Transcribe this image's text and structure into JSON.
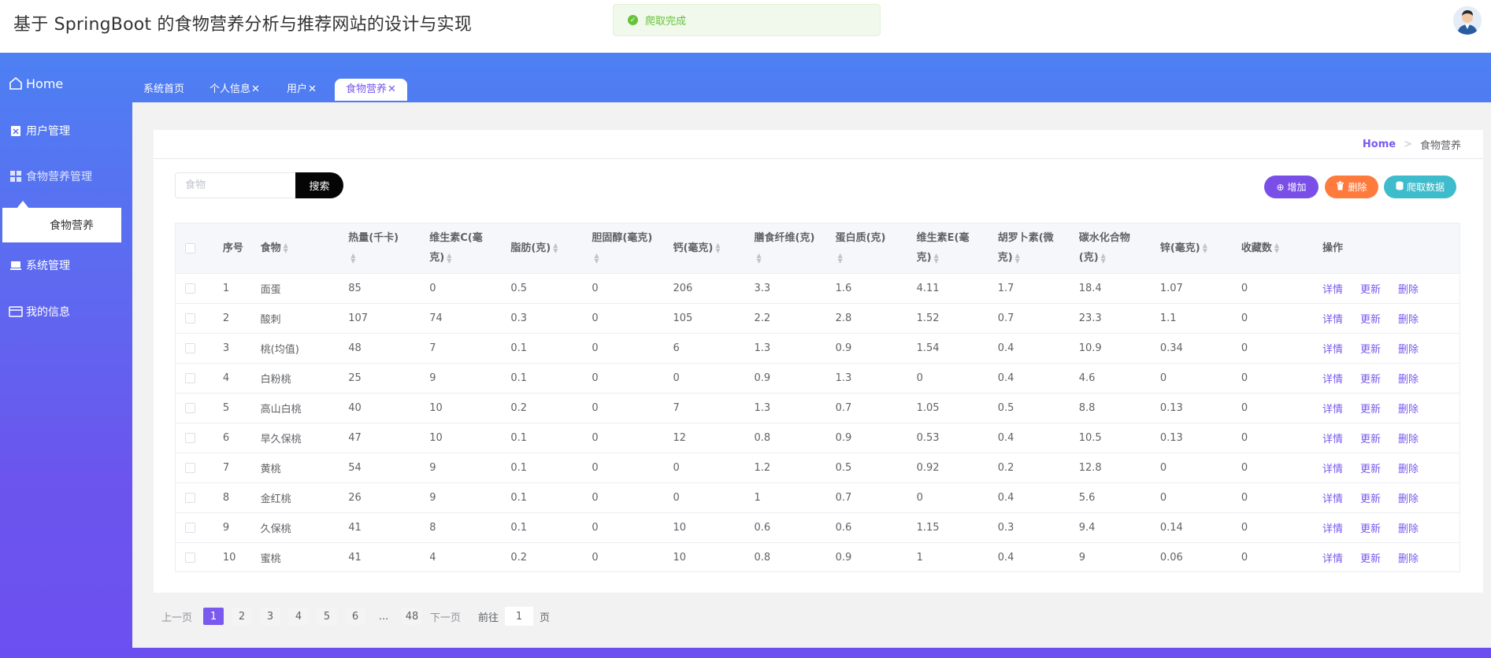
{
  "header": {
    "title": "基于 SpringBoot 的食物营养分析与推荐网站的设计与实现",
    "avatar_icon": "user-avatar-icon"
  },
  "toast": {
    "message": "爬取完成",
    "color": "#67c23a"
  },
  "sidebar": {
    "items": [
      {
        "label": "Home",
        "icon": "home-icon"
      },
      {
        "label": "用户管理",
        "icon": "clipboard-icon"
      },
      {
        "label": "食物营养管理",
        "icon": "grid-icon"
      },
      {
        "label": "系统管理",
        "icon": "laptop-icon"
      },
      {
        "label": "我的信息",
        "icon": "card-icon"
      }
    ],
    "sub_item": "食物营养"
  },
  "tabs": [
    {
      "label": "系统首页",
      "closable": false
    },
    {
      "label": "个人信息",
      "closable": true
    },
    {
      "label": "用户",
      "closable": true
    },
    {
      "label": "食物营养",
      "closable": true,
      "active": true
    }
  ],
  "breadcrumb": {
    "home": "Home",
    "separator": ">",
    "current": "食物营养"
  },
  "search": {
    "placeholder": "食物",
    "button": "搜索"
  },
  "actions": {
    "add": "增加",
    "delete": "删除",
    "crawl": "爬取数据"
  },
  "table": {
    "columns": [
      "序号",
      "食物",
      "热量(千卡)",
      "维生素C(毫克)",
      "脂肪(克)",
      "胆固醇(毫克)",
      "钙(毫克)",
      "膳食纤维(克)",
      "蛋白质(克)",
      "维生素E(毫克)",
      "胡罗卜素(微克)",
      "碳水化合物(克)",
      "锌(毫克)",
      "收藏数",
      "操作"
    ],
    "row_actions": {
      "detail": "详情",
      "update": "更新",
      "delete": "删除"
    },
    "rows": [
      [
        "1",
        "面蛋",
        "85",
        "0",
        "0.5",
        "0",
        "206",
        "3.3",
        "1.6",
        "4.11",
        "1.7",
        "18.4",
        "1.07",
        "0"
      ],
      [
        "2",
        "酸刺",
        "107",
        "74",
        "0.3",
        "0",
        "105",
        "2.2",
        "2.8",
        "1.52",
        "0.7",
        "23.3",
        "1.1",
        "0"
      ],
      [
        "3",
        "桃(均值)",
        "48",
        "7",
        "0.1",
        "0",
        "6",
        "1.3",
        "0.9",
        "1.54",
        "0.4",
        "10.9",
        "0.34",
        "0"
      ],
      [
        "4",
        "白粉桃",
        "25",
        "9",
        "0.1",
        "0",
        "0",
        "0.9",
        "1.3",
        "0",
        "0.4",
        "4.6",
        "0",
        "0"
      ],
      [
        "5",
        "高山白桃",
        "40",
        "10",
        "0.2",
        "0",
        "7",
        "1.3",
        "0.7",
        "1.05",
        "0.5",
        "8.8",
        "0.13",
        "0"
      ],
      [
        "6",
        "旱久保桃",
        "47",
        "10",
        "0.1",
        "0",
        "12",
        "0.8",
        "0.9",
        "0.53",
        "0.4",
        "10.5",
        "0.13",
        "0"
      ],
      [
        "7",
        "黄桃",
        "54",
        "9",
        "0.1",
        "0",
        "0",
        "1.2",
        "0.5",
        "0.92",
        "0.2",
        "12.8",
        "0",
        "0"
      ],
      [
        "8",
        "金红桃",
        "26",
        "9",
        "0.1",
        "0",
        "0",
        "1",
        "0.7",
        "0",
        "0.4",
        "5.6",
        "0",
        "0"
      ],
      [
        "9",
        "久保桃",
        "41",
        "8",
        "0.1",
        "0",
        "10",
        "0.6",
        "0.6",
        "1.15",
        "0.3",
        "9.4",
        "0.14",
        "0"
      ],
      [
        "10",
        "蜜桃",
        "41",
        "4",
        "0.2",
        "0",
        "10",
        "0.8",
        "0.9",
        "1",
        "0.4",
        "9",
        "0.06",
        "0"
      ]
    ]
  },
  "pagination": {
    "prev": "上一页",
    "pages": [
      "1",
      "2",
      "3",
      "4",
      "5",
      "6"
    ],
    "ellipsis": "...",
    "last": "48",
    "next": "下一页",
    "goto_label": "前往",
    "goto_value": "1",
    "goto_suffix": "页",
    "current": 1
  },
  "colors": {
    "accent": "#7a59ef",
    "add": "#7a4fe8",
    "delete": "#ff7b3d",
    "crawl": "#3ebccb",
    "gradient_top": "#4d80f3",
    "gradient_bottom": "#6c4ff0"
  }
}
